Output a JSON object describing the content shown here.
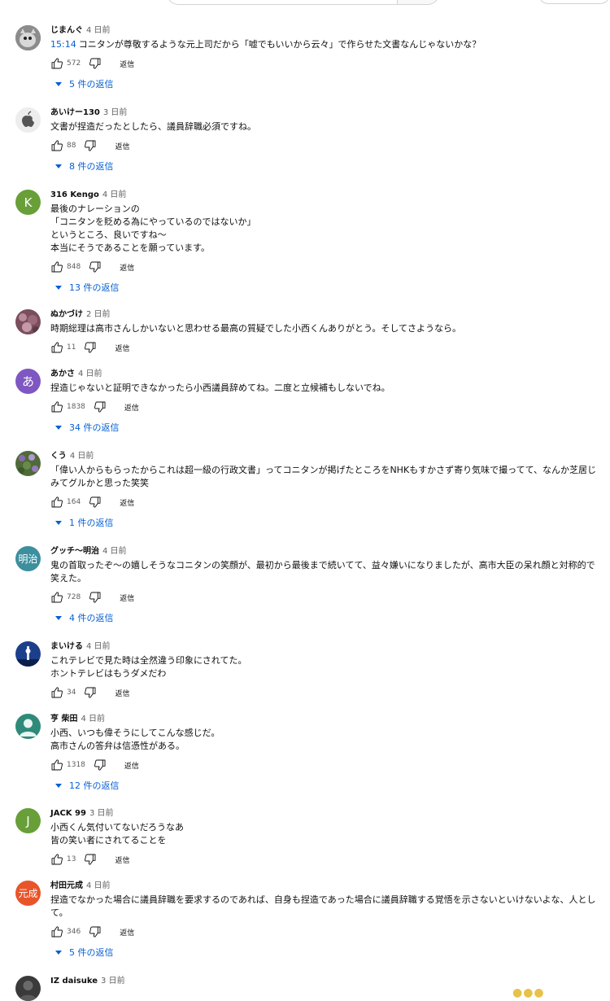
{
  "comments": [
    {
      "author": "じまんぐ",
      "time": "4 日前",
      "timestamp": "15:14",
      "lines": [
        "コニタンが尊敬するような元上司だから「嘘でもいいから云々」で作らせた文書なんじゃないかな？"
      ],
      "likes": "572",
      "reply_label": "返信",
      "replies": "5 件の返信",
      "avatar": {
        "type": "photo",
        "color": "#6a6a6a",
        "icon": "cat-photo-avatar"
      }
    },
    {
      "author": "あいけー130",
      "time": "3 日前",
      "lines": [
        "文書が捏造だったとしたら、議員辞職必須ですね。"
      ],
      "likes": "88",
      "reply_label": "返信",
      "replies": "8 件の返信",
      "avatar": {
        "type": "photo",
        "color": "#e6e6e6",
        "icon": "apple-logo-avatar"
      }
    },
    {
      "author": "316 Kengo",
      "time": "4 日前",
      "lines": [
        "最後のナレーションの",
        "「コニタンを貶める為にやっているのではないか」",
        "というところ、良いですね〜",
        "本当にそうであることを願っています。"
      ],
      "likes": "848",
      "reply_label": "返信",
      "replies": "13 件の返信",
      "avatar": {
        "type": "letter",
        "letter": "K",
        "color": "#689f38"
      }
    },
    {
      "author": "ぬかづけ",
      "time": "2 日前",
      "lines": [
        "時期総理は高市さんしかいないと思わせる最高の質疑でした小西くんありがとう。そしてさようなら。"
      ],
      "likes": "11",
      "reply_label": "返信",
      "avatar": {
        "type": "photo",
        "color": "#8a5a6a",
        "icon": "flower-photo-avatar"
      }
    },
    {
      "author": "あかさ",
      "time": "4 日前",
      "lines": [
        "捏造じゃないと証明できなかったら小西議員辞めてね。二度と立候補もしないでね。"
      ],
      "likes": "1838",
      "reply_label": "返信",
      "replies": "34 件の返信",
      "avatar": {
        "type": "letter",
        "letter": "あ",
        "color": "#7e57c2"
      }
    },
    {
      "author": "くう",
      "time": "4 日前",
      "lines": [
        "「偉い人からもらったからこれは超一級の行政文書」ってコニタンが掲げたところをNHKもすかさず寄り気味で撮ってて、なんか芝居じみてグルかと思った笑笑"
      ],
      "likes": "164",
      "reply_label": "返信",
      "replies": "1 件の返信",
      "avatar": {
        "type": "photo",
        "color": "#5a6a3a",
        "icon": "garden-photo-avatar"
      }
    },
    {
      "author": "グッチ〜明治",
      "time": "4 日前",
      "lines": [
        "鬼の首取ったぞ〜の嬉しそうなコニタンの笑顔が、最初から最後まで続いてて、益々嫌いになりましたが、高市大臣の呆れ顔と対称的で笑えた。"
      ],
      "likes": "728",
      "reply_label": "返信",
      "replies": "4 件の返信",
      "avatar": {
        "type": "letter",
        "letter": "明治",
        "color": "#3d8f9e"
      }
    },
    {
      "author": "まいける",
      "time": "4 日前",
      "lines": [
        "これテレビで見た時は全然違う印象にされてた。",
        "ホントテレビはもうダメだわ"
      ],
      "likes": "34",
      "reply_label": "返信",
      "avatar": {
        "type": "photo",
        "color": "#1c3f8c",
        "icon": "tower-photo-avatar"
      }
    },
    {
      "author": "亨 柴田",
      "time": "4 日前",
      "lines": [
        "小西、いつも偉そうにしてこんな感じだ。",
        "高市さんの答弁は信憑性がある。"
      ],
      "likes": "1318",
      "reply_label": "返信",
      "replies": "12 件の返信",
      "avatar": {
        "type": "default",
        "color": "#2f8a7a",
        "icon": "person-silhouette-avatar"
      }
    },
    {
      "author": "JACK 99",
      "time": "3 日前",
      "lines": [
        "小西くん気付いてないだろうなあ",
        "皆の笑い者にされてることを"
      ],
      "likes": "13",
      "reply_label": "返信",
      "avatar": {
        "type": "letter",
        "letter": "J",
        "color": "#689f38"
      }
    },
    {
      "author": "村田元成",
      "time": "4 日前",
      "lines": [
        "捏造でなかった場合に議員辞職を要求するのであれば、自身も捏造であった場合に議員辞職する覚悟を示さないといけないよな、人として。"
      ],
      "likes": "346",
      "reply_label": "返信",
      "replies": "5 件の返信",
      "avatar": {
        "type": "letter",
        "letter": "元成",
        "color": "#e8552a"
      }
    },
    {
      "author": "IZ daisuke",
      "time": "3 日前",
      "lines": [],
      "avatar": {
        "type": "photo",
        "color": "#333333",
        "icon": "person-photo-avatar"
      }
    }
  ]
}
